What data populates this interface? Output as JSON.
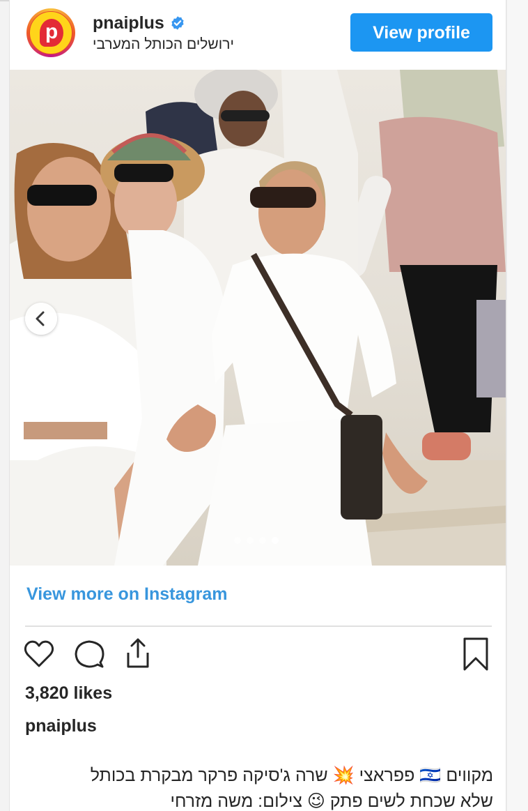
{
  "header": {
    "username": "pnaiplus",
    "location": "ירושלים הכותל המערבי",
    "avatar_letter": "p",
    "view_profile_label": "View profile"
  },
  "photo": {
    "slide_count": 4,
    "active_slide": 4
  },
  "view_more_label": "View more on Instagram",
  "likes": "3,820 likes",
  "caption_username": "pnaiplus",
  "caption_lines": [
    "מקווים 🇮🇱 פפראצי 💥 שרה ג'סיקה פרקר מבקרת בכותל",
    "שלא שכחת לשים פתק 😉 צילום: משה מזרחי"
  ],
  "colors": {
    "accent_blue": "#1c96f2",
    "link_blue": "#3896dd",
    "text": "#262626",
    "verified_blue": "#3897f0"
  },
  "icons": [
    "heart-icon",
    "comment-icon",
    "share-icon",
    "bookmark-icon",
    "verified-icon",
    "chevron-left-icon"
  ]
}
